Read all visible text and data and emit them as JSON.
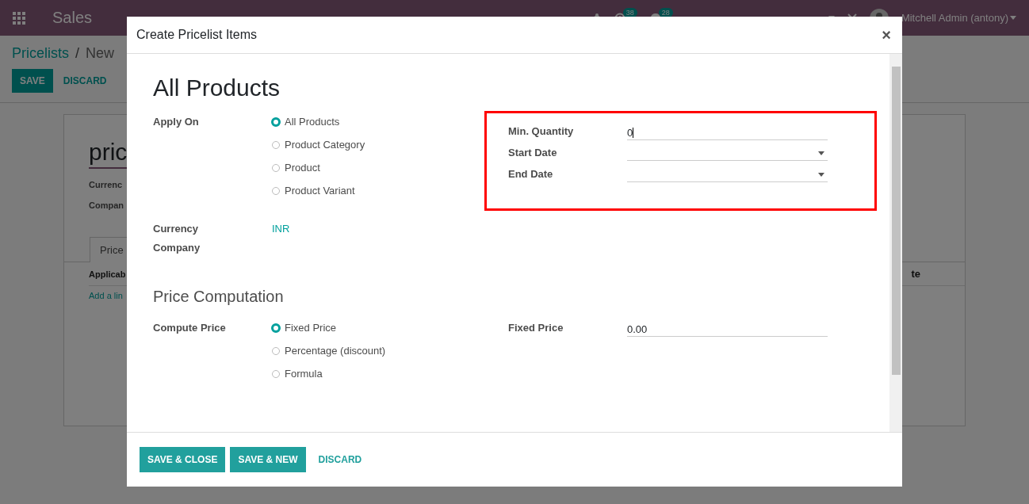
{
  "navbar": {
    "app_name": "Sales",
    "activity_count": "38",
    "message_count": "28",
    "user": "Mitchell Admin (antony)"
  },
  "breadcrumb": {
    "parent": "Pricelists",
    "separator": "/",
    "current": "New"
  },
  "control_buttons": [
    {
      "label": "SAVE",
      "kind": "primary"
    },
    {
      "label": "DISCARD",
      "kind": "link"
    }
  ],
  "form_behind": {
    "name": "pric",
    "fields": [
      "Currenc",
      "Compan"
    ],
    "tab": "Price",
    "column_1": "Applicab",
    "add_line": "Add a lin",
    "column_2": "te"
  },
  "dialog": {
    "title": "Create Pricelist Items",
    "close": "×",
    "heading": "All Products",
    "apply_on": {
      "label": "Apply On",
      "options": [
        {
          "label": "All Products",
          "selected": true
        },
        {
          "label": "Product Category",
          "selected": false
        },
        {
          "label": "Product",
          "selected": false
        },
        {
          "label": "Product Variant",
          "selected": false
        }
      ]
    },
    "currency": {
      "label": "Currency",
      "value": "INR"
    },
    "company": {
      "label": "Company"
    },
    "right_group": {
      "highlighted": true,
      "fields": [
        {
          "kind": "text",
          "label": "Min. Quantity",
          "value": "0",
          "focused": true
        },
        {
          "kind": "date",
          "label": "Start Date"
        },
        {
          "kind": "date",
          "label": "End Date"
        }
      ]
    },
    "section_title": "Price Computation",
    "compute_price": {
      "label": "Compute Price",
      "options": [
        {
          "label": "Fixed Price",
          "selected": true
        },
        {
          "label": "Percentage (discount)",
          "selected": false
        },
        {
          "label": "Formula",
          "selected": false
        }
      ]
    },
    "fixed_price": {
      "label": "Fixed Price",
      "value": "0.00"
    },
    "buttons": [
      {
        "label": "SAVE & CLOSE",
        "kind": "primary"
      },
      {
        "label": "SAVE & NEW",
        "kind": "primary"
      },
      {
        "label": "DISCARD",
        "kind": "link"
      }
    ]
  }
}
